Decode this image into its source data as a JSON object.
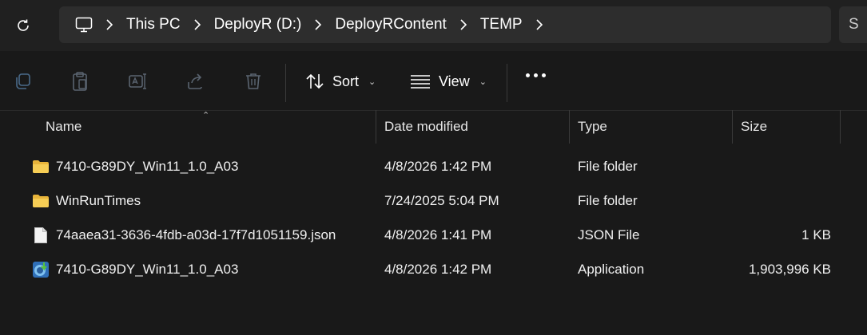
{
  "address": {
    "crumbs": [
      "This PC",
      "DeployR (D:)",
      "DeployRContent",
      "TEMP"
    ],
    "search_stub": "S"
  },
  "toolbar": {
    "sort_label": "Sort",
    "view_label": "View"
  },
  "columns": {
    "name": "Name",
    "date": "Date modified",
    "type": "Type",
    "size": "Size"
  },
  "files": [
    {
      "name": "7410-G89DY_Win11_1.0_A03",
      "date": "4/8/2026 1:42 PM",
      "type": "File folder",
      "size": "",
      "icon": "folder-icon"
    },
    {
      "name": "WinRunTimes",
      "date": "7/24/2025 5:04 PM",
      "type": "File folder",
      "size": "",
      "icon": "folder-icon"
    },
    {
      "name": "74aaea31-3636-4fdb-a03d-17f7d1051159.json",
      "date": "4/8/2026 1:41 PM",
      "type": "JSON File",
      "size": "1 KB",
      "icon": "file-icon"
    },
    {
      "name": "7410-G89DY_Win11_1.0_A03",
      "date": "4/8/2026 1:42 PM",
      "type": "Application",
      "size": "1,903,996 KB",
      "icon": "application-icon"
    }
  ],
  "colors": {
    "background": "#191919",
    "address_bar": "#2d2d2d",
    "folder": "#f2c94c"
  }
}
